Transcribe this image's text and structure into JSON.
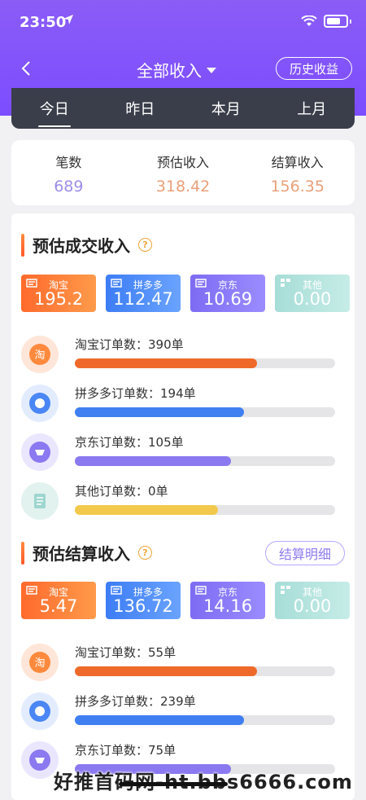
{
  "status": {
    "time": "23:50"
  },
  "nav": {
    "title": "全部收入",
    "history_label": "历史收益"
  },
  "period_tabs": [
    {
      "label": "今日",
      "active": true
    },
    {
      "label": "昨日",
      "active": false
    },
    {
      "label": "本月",
      "active": false
    },
    {
      "label": "上月",
      "active": false
    }
  ],
  "summary": [
    {
      "label": "笔数",
      "value": "689",
      "color": "#9d8ee6"
    },
    {
      "label": "预估收入",
      "value": "318.42",
      "color": "#e9a07a"
    },
    {
      "label": "结算收入",
      "value": "156.35",
      "color": "#e9a07a"
    }
  ],
  "estimated_deal": {
    "title": "预估成交收入",
    "help": "?",
    "platforms": [
      {
        "name": "淘宝",
        "value": "195.2",
        "icon": "taobao-icon"
      },
      {
        "name": "拼多多",
        "value": "112.47",
        "icon": "pinduoduo-icon"
      },
      {
        "name": "京东",
        "value": "10.69",
        "icon": "jd-icon"
      },
      {
        "name": "其他",
        "value": "0.00",
        "icon": "other-icon"
      }
    ],
    "orders": [
      {
        "label": "淘宝订单数：390单",
        "progress": 0.7,
        "color": "#ef6a2a"
      },
      {
        "label": "拼多多订单数：194单",
        "progress": 0.65,
        "color": "#3f7ff2"
      },
      {
        "label": "京东订单数：105单",
        "progress": 0.6,
        "color": "#8a79f0"
      },
      {
        "label": "其他订单数：0单",
        "progress": 0.55,
        "color": "#f2c94c"
      }
    ]
  },
  "estimated_settle": {
    "title": "预估结算收入",
    "help": "?",
    "detail_label": "结算明细",
    "platforms": [
      {
        "name": "淘宝",
        "value": "5.47",
        "icon": "taobao-icon"
      },
      {
        "name": "拼多多",
        "value": "136.72",
        "icon": "pinduoduo-icon"
      },
      {
        "name": "京东",
        "value": "14.16",
        "icon": "jd-icon"
      },
      {
        "name": "其他",
        "value": "0.00",
        "icon": "other-icon"
      }
    ],
    "orders": [
      {
        "label": "淘宝订单数：55单",
        "progress": 0.7,
        "color": "#ef6a2a"
      },
      {
        "label": "拼多多订单数：239单",
        "progress": 0.65,
        "color": "#3f7ff2"
      },
      {
        "label": "京东订单数：75单",
        "progress": 0.6,
        "color": "#8a79f0"
      }
    ]
  },
  "watermark": "好推首码网-ht.bbs6666.com"
}
